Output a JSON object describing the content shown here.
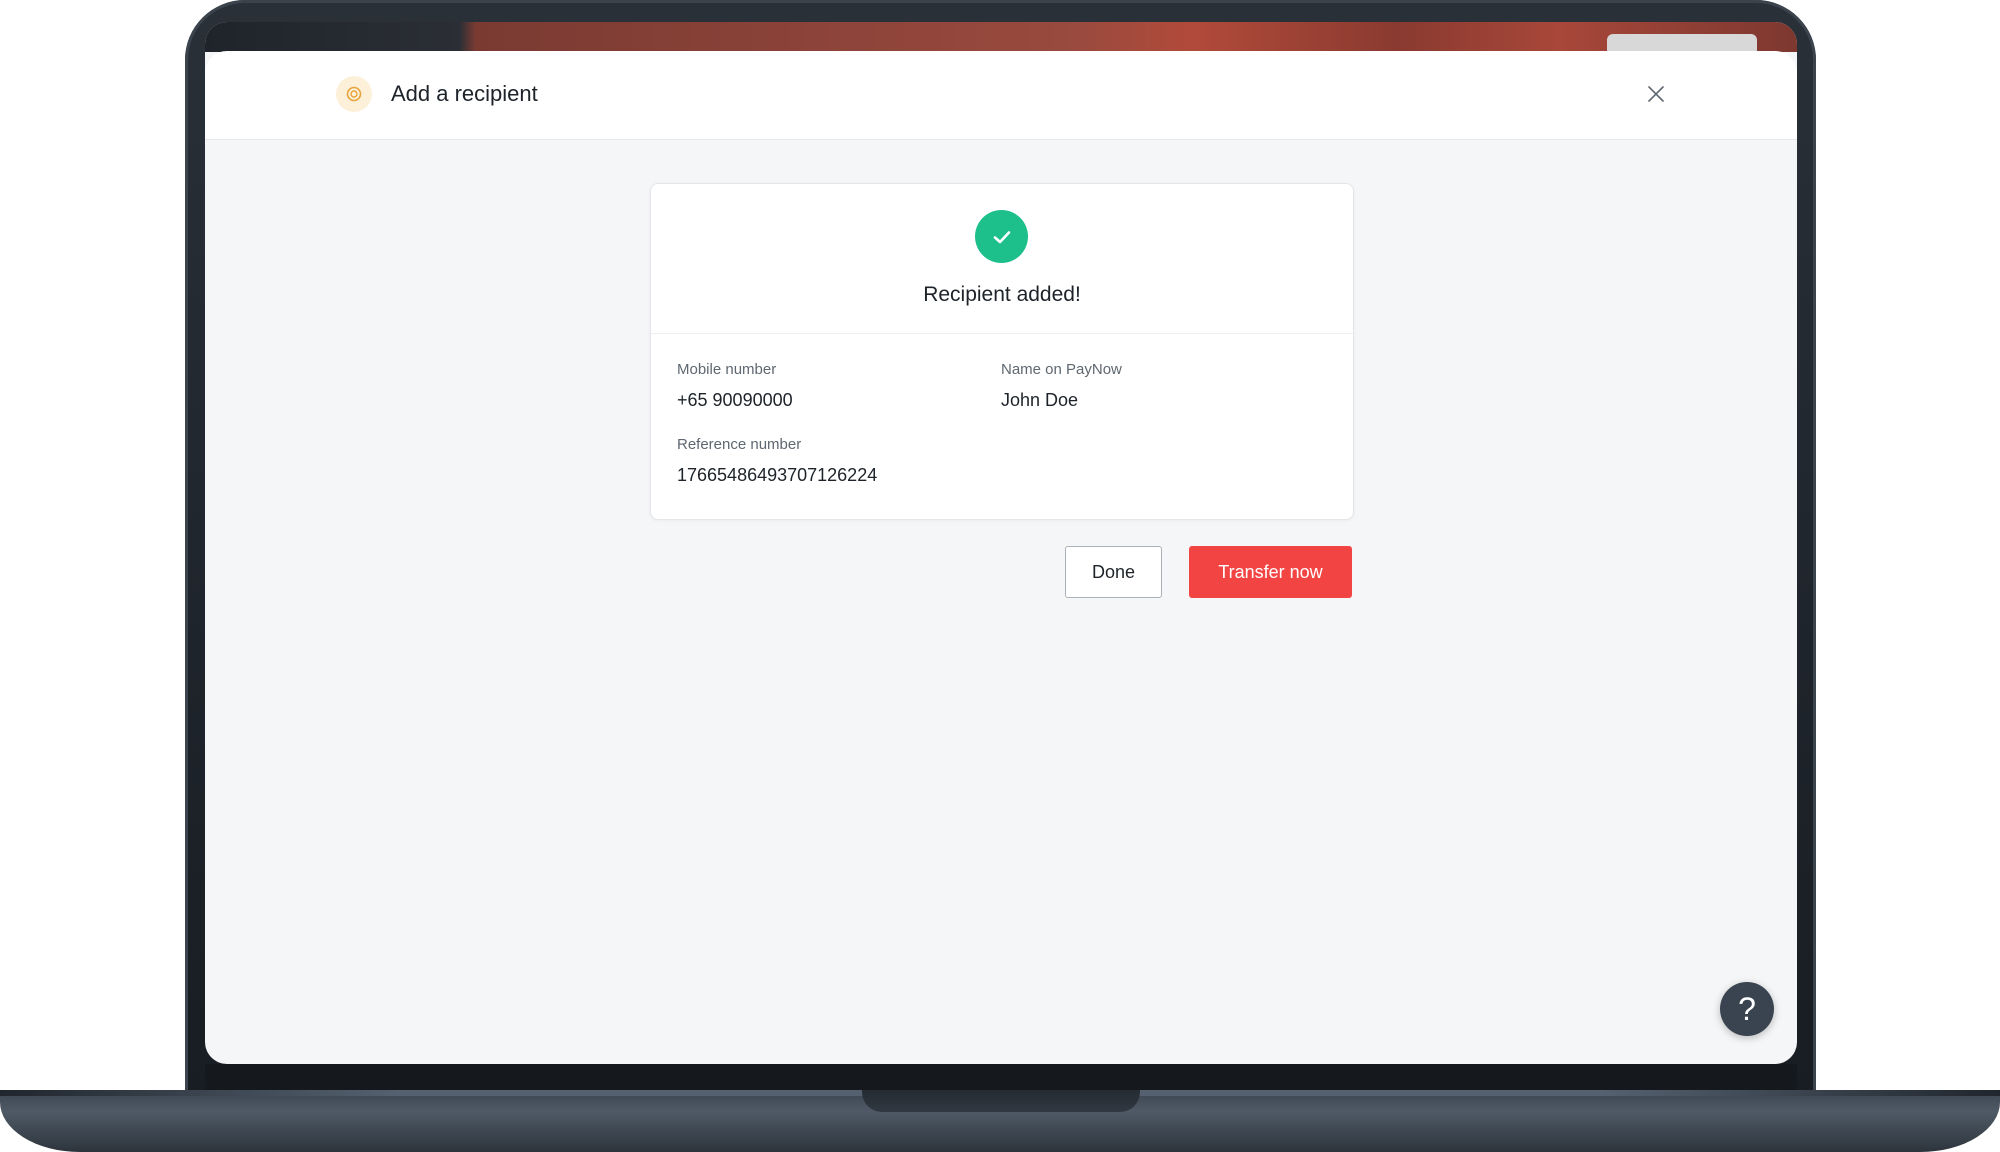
{
  "modal": {
    "title": "Add a recipient",
    "header_icon": "paynow-coin-icon",
    "close_icon": "close-icon"
  },
  "result": {
    "icon": "check-circle-icon",
    "title": "Recipient added!"
  },
  "details": {
    "mobile_label": "Mobile number",
    "mobile_value": "+65 90090000",
    "name_label": "Name on PayNow",
    "name_value": "John Doe",
    "reference_label": "Reference number",
    "reference_value": "17665486493707126224"
  },
  "actions": {
    "done_label": "Done",
    "transfer_label": "Transfer now"
  },
  "help": {
    "label": "?"
  },
  "colors": {
    "success": "#1dbf8a",
    "primary": "#f34444",
    "accent_icon": "#e8a33a"
  }
}
